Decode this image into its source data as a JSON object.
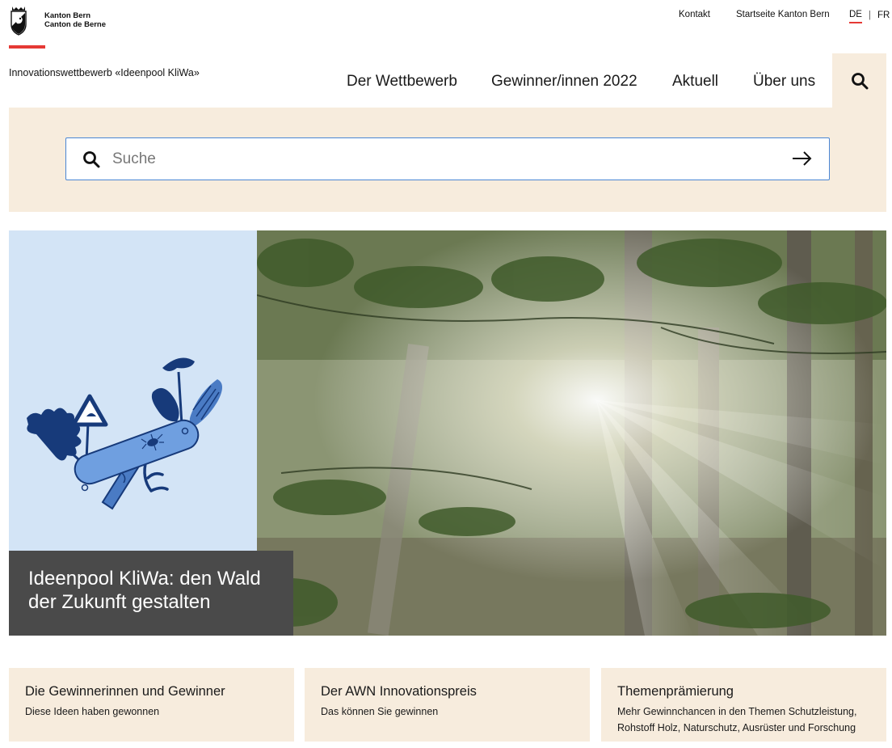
{
  "header": {
    "logo_line1": "Kanton Bern",
    "logo_line2": "Canton de Berne",
    "meta": {
      "kontakt": "Kontakt",
      "startseite": "Startseite Kanton Bern"
    },
    "lang": {
      "active": "DE",
      "other": "FR"
    },
    "site_title": "Innovationswettbewerb «Ideenpool KliWa»",
    "nav": [
      "Der Wettbewerb",
      "Gewinner/innen 2022",
      "Aktuell",
      "Über uns"
    ],
    "accent_color": "#e53935",
    "search_icon": "search-icon"
  },
  "search": {
    "placeholder": "Suche",
    "value": "",
    "submit_icon": "arrow-right-icon"
  },
  "hero": {
    "caption": "Ideenpool KliWa: den Wald der Zukunft gestalten",
    "illustration": "multi-tool-icon",
    "photo": "forest-sunlight-photo"
  },
  "cards": [
    {
      "title": "Die Gewinnerinnen und Gewinner",
      "text": "Diese Ideen haben gewonnen"
    },
    {
      "title": "Der AWN Innovationspreis",
      "text": "Das können Sie gewinnen"
    },
    {
      "title": "Themenprämierung",
      "text": "Mehr Gewinnchancen in den Themen Schutzleistung, Rohstoff Holz, Naturschutz, Ausrüster und Forschung"
    }
  ],
  "colors": {
    "panel_bg": "#f7ecdd",
    "illu_bg": "#d3e4f6",
    "caption_bg": "#4a4a4a",
    "focus_border": "#4a86d4"
  }
}
